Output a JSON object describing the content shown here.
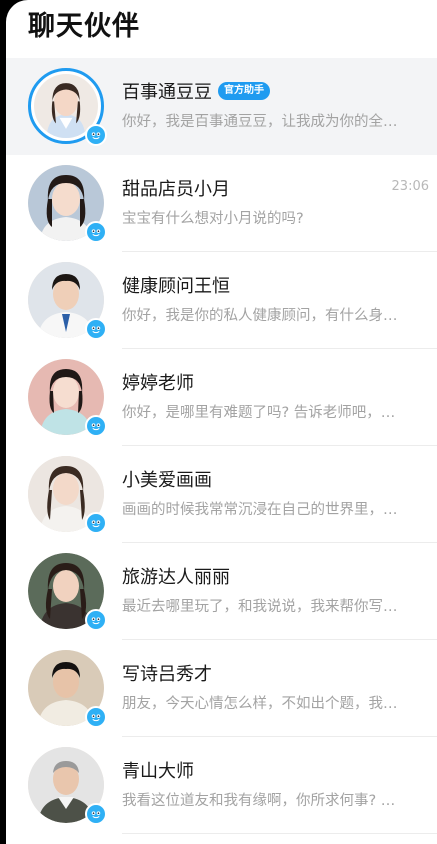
{
  "header": {
    "title": "聊天伙伴"
  },
  "conversations": [
    {
      "name": "百事通豆豆",
      "tag": "官方助手",
      "time": "",
      "preview": "你好，我是百事通豆豆，让我成为你的全…",
      "avatar": "avatar-official-assistant",
      "highlight": true
    },
    {
      "name": "甜品店员小月",
      "tag": "",
      "time": "23:06",
      "preview": "宝宝有什么想对小月说的吗?",
      "avatar": "avatar-xiaoyue"
    },
    {
      "name": "健康顾问王恒",
      "tag": "",
      "time": "",
      "preview": "你好，我是你的私人健康顾问，有什么身…",
      "avatar": "avatar-wangheng"
    },
    {
      "name": "婷婷老师",
      "tag": "",
      "time": "",
      "preview": "你好，是哪里有难题了吗? 告诉老师吧，…",
      "avatar": "avatar-tingting"
    },
    {
      "name": "小美爱画画",
      "tag": "",
      "time": "",
      "preview": "画画的时候我常常沉浸在自己的世界里，…",
      "avatar": "avatar-xiaomei"
    },
    {
      "name": "旅游达人丽丽",
      "tag": "",
      "time": "",
      "preview": "最近去哪里玩了，和我说说，我来帮你写…",
      "avatar": "avatar-lili"
    },
    {
      "name": "写诗吕秀才",
      "tag": "",
      "time": "",
      "preview": "朋友，今天心情怎么样，不如出个题，我…",
      "avatar": "avatar-lvxiucai"
    },
    {
      "name": "青山大师",
      "tag": "",
      "time": "",
      "preview": "我看这位道友和我有缘啊，你所求何事? …",
      "avatar": "avatar-qingshan"
    }
  ],
  "colors": {
    "accent": "#1f9bf0",
    "badge": "#2fb0f5"
  }
}
